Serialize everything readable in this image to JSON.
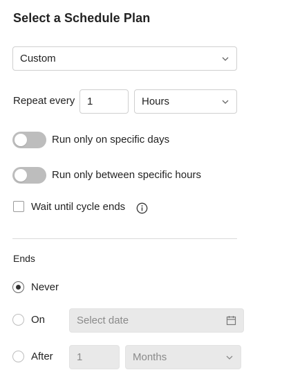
{
  "title": "Select a Schedule Plan",
  "plan_select": {
    "value": "Custom",
    "icon": "chevron-down-icon"
  },
  "repeat": {
    "label": "Repeat every",
    "value": "1",
    "unit": "Hours",
    "unit_icon": "chevron-down-icon"
  },
  "toggles": [
    {
      "label": "Run only on specific days",
      "on": false
    },
    {
      "label": "Run only between specific hours",
      "on": false
    }
  ],
  "wait": {
    "label": "Wait until cycle ends",
    "checked": false,
    "icon": "info-icon"
  },
  "ends": {
    "heading": "Ends",
    "never": {
      "label": "Never",
      "selected": true
    },
    "on": {
      "label": "On",
      "selected": false,
      "date_placeholder": "Select date",
      "icon": "calendar-icon"
    },
    "after": {
      "label": "After",
      "selected": false,
      "count": "1",
      "unit": "Months",
      "icon": "chevron-down-icon"
    }
  }
}
